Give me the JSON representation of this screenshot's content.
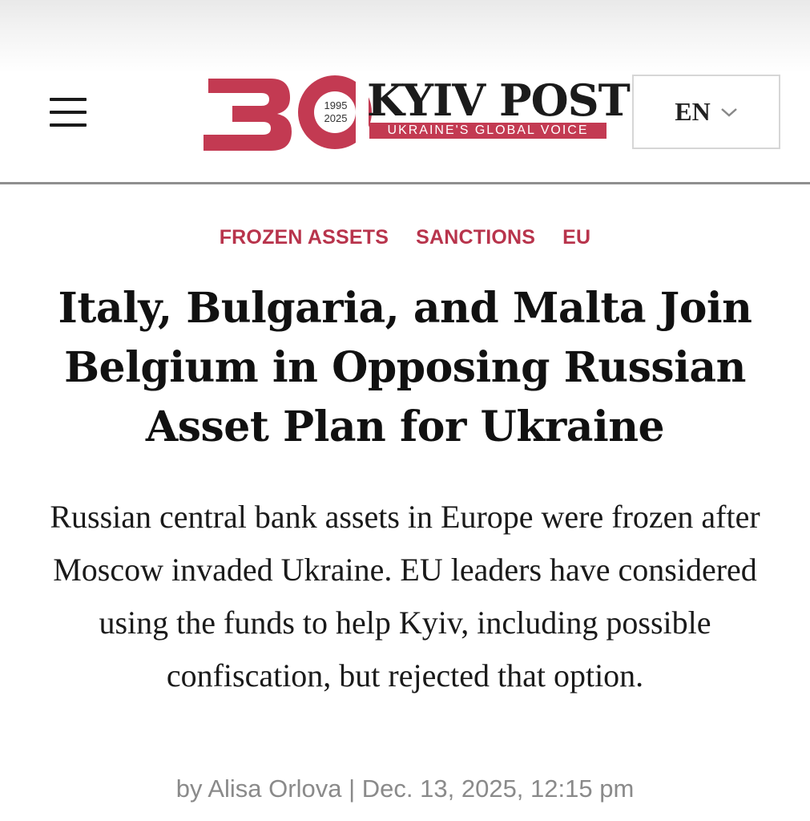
{
  "header": {
    "menu_icon": "hamburger-menu-icon",
    "logo": {
      "number": "30",
      "year_start": "1995",
      "year_end": "2025",
      "name": "KYIV POST",
      "tagline": "UKRAINE'S GLOBAL VOICE",
      "brand_color": "#c33a52"
    },
    "language": {
      "label": "EN",
      "icon": "chevron-down-icon"
    }
  },
  "article": {
    "tags": [
      "FROZEN ASSETS",
      "SANCTIONS",
      "EU"
    ],
    "tag_color": "#b8344c",
    "headline": "Italy, Bulgaria, and Malta Join Belgium in Opposing Russian Asset Plan for Ukraine",
    "summary": "Russian central bank assets in Europe were frozen after Moscow invaded Ukraine. EU leaders have considered using the funds to help Kyiv, including possible confiscation, but rejected that option.",
    "byline": {
      "prefix": "by",
      "author": "Alisa Orlova",
      "separator": "|",
      "date": "Dec. 13, 2025, 12:15 pm"
    }
  }
}
